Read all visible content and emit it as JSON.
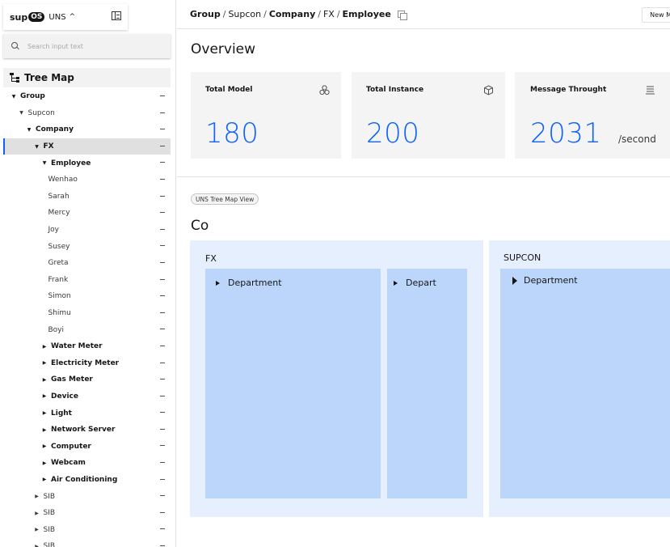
{
  "sidebar": {
    "logo": {
      "prefix": "sup",
      "badge": "OS",
      "module": "UNS",
      "chevron": "^"
    },
    "search_placeholder": "Search input text",
    "tree_title": "Tree Map",
    "tree": [
      {
        "label": "Group",
        "indent": 0,
        "caret": "▼",
        "bold": true
      },
      {
        "label": "Supcon",
        "indent": 1,
        "caret": "▼",
        "bold": false
      },
      {
        "label": "Company",
        "indent": 2,
        "caret": "▼",
        "bold": true
      },
      {
        "label": "FX",
        "indent": 3,
        "caret": "▼",
        "bold": true,
        "selected": true
      },
      {
        "label": "Employee",
        "indent": 4,
        "caret": "▼",
        "bold": true
      },
      {
        "label": "Wenhao",
        "indent": 5,
        "caret": "",
        "bold": false
      },
      {
        "label": "Sarah",
        "indent": 5,
        "caret": "",
        "bold": false
      },
      {
        "label": "Mercy",
        "indent": 5,
        "caret": "",
        "bold": false
      },
      {
        "label": "Joy",
        "indent": 5,
        "caret": "",
        "bold": false
      },
      {
        "label": "Susey",
        "indent": 5,
        "caret": "",
        "bold": false
      },
      {
        "label": "Greta",
        "indent": 5,
        "caret": "",
        "bold": false
      },
      {
        "label": "Frank",
        "indent": 5,
        "caret": "",
        "bold": false
      },
      {
        "label": "Simon",
        "indent": 5,
        "caret": "",
        "bold": false
      },
      {
        "label": "Shimu",
        "indent": 5,
        "caret": "",
        "bold": false
      },
      {
        "label": "Boyi",
        "indent": 5,
        "caret": "",
        "bold": false
      },
      {
        "label": "Water Meter",
        "indent": 4,
        "caret": "▶",
        "bold": true
      },
      {
        "label": "Electricity Meter",
        "indent": 4,
        "caret": "▶",
        "bold": true
      },
      {
        "label": "Gas Meter",
        "indent": 4,
        "caret": "▶",
        "bold": true
      },
      {
        "label": "Device",
        "indent": 4,
        "caret": "▶",
        "bold": true
      },
      {
        "label": "Light",
        "indent": 4,
        "caret": "▶",
        "bold": true
      },
      {
        "label": "Network Server",
        "indent": 4,
        "caret": "▶",
        "bold": true
      },
      {
        "label": "Computer",
        "indent": 4,
        "caret": "▶",
        "bold": true
      },
      {
        "label": "Webcam",
        "indent": 4,
        "caret": "▶",
        "bold": true
      },
      {
        "label": "Air Conditioning",
        "indent": 4,
        "caret": "▶",
        "bold": true
      },
      {
        "label": "SIB",
        "indent": 3,
        "caret": "▶",
        "bold": false
      },
      {
        "label": "SIB",
        "indent": 3,
        "caret": "▶",
        "bold": false
      },
      {
        "label": "SIB",
        "indent": 3,
        "caret": "▶",
        "bold": false
      },
      {
        "label": "SIB",
        "indent": 3,
        "caret": "▶",
        "bold": false
      }
    ]
  },
  "header": {
    "breadcrumb": [
      "Group",
      "Supcon",
      "Company",
      "FX",
      "Employee"
    ],
    "new_button": "New M"
  },
  "main": {
    "overview_title": "Overview",
    "cards": [
      {
        "label": "Total Model",
        "value": "180",
        "unit": "",
        "icon": "model-icon"
      },
      {
        "label": "Total Instance",
        "value": "200",
        "unit": "",
        "icon": "instance-icon"
      },
      {
        "label": "Message Throught",
        "value": "2031",
        "unit": "/second",
        "icon": "message-icon"
      }
    ],
    "tag": "UNS Tree Map View",
    "section_title": "Co",
    "groups": [
      {
        "label": "FX",
        "departments": [
          "Department",
          "Depart"
        ]
      },
      {
        "label": "SUPCON",
        "departments": [
          "Department"
        ]
      }
    ]
  },
  "colors": {
    "accent": "#0f62fe",
    "group_bg": "#e5effe",
    "dept_bg": "#bcd6fb",
    "card_bg": "#f4f4f4"
  }
}
